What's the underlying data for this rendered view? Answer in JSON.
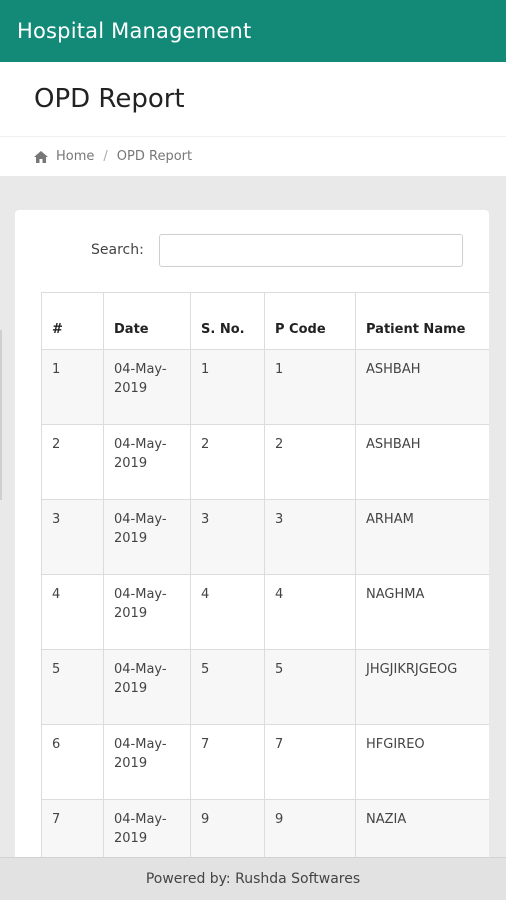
{
  "app": {
    "title": "Hospital Management"
  },
  "header": {
    "page_title": "OPD Report"
  },
  "breadcrumb": {
    "home": "Home",
    "separator": "/",
    "current": "OPD Report"
  },
  "search": {
    "label": "Search:",
    "value": ""
  },
  "table": {
    "headers": {
      "num": "#",
      "date": "Date",
      "sno": "S. No.",
      "pcode": "P Code",
      "name": "Patient Name"
    },
    "rows": [
      {
        "num": "1",
        "date": "04-May-2019",
        "sno": "1",
        "pcode": "1",
        "name": "ASHBAH"
      },
      {
        "num": "2",
        "date": "04-May-2019",
        "sno": "2",
        "pcode": "2",
        "name": "ASHBAH"
      },
      {
        "num": "3",
        "date": "04-May-2019",
        "sno": "3",
        "pcode": "3",
        "name": "ARHAM"
      },
      {
        "num": "4",
        "date": "04-May-2019",
        "sno": "4",
        "pcode": "4",
        "name": "NAGHMA"
      },
      {
        "num": "5",
        "date": "04-May-2019",
        "sno": "5",
        "pcode": "5",
        "name": "JHGJIKRJGEOG"
      },
      {
        "num": "6",
        "date": "04-May-2019",
        "sno": "7",
        "pcode": "7",
        "name": "HFGIREO"
      },
      {
        "num": "7",
        "date": "04-May-2019",
        "sno": "9",
        "pcode": "9",
        "name": "NAZIA"
      }
    ]
  },
  "footer": {
    "text": "Powered by: Rushda Softwares"
  },
  "colors": {
    "brand": "#138a78",
    "page_bg": "#e9e9e9"
  },
  "icons": {
    "breadcrumb_home": "home-icon"
  }
}
